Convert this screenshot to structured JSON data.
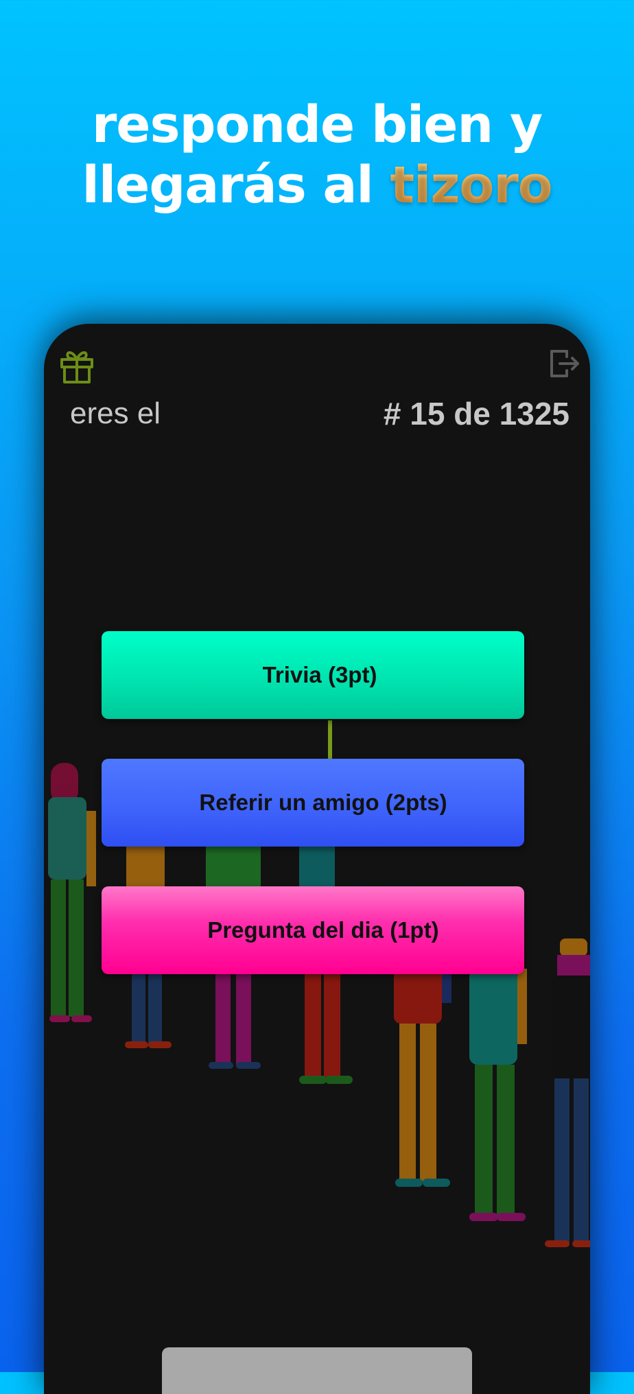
{
  "headline": {
    "line1": "responde bien y",
    "line2_prefix": "llegarás al ",
    "line2_accent": "tizoro"
  },
  "header": {
    "gift_icon": "gift-icon",
    "logout_icon": "logout-icon",
    "rank_label": "eres el",
    "rank_value": "# 15 de 1325"
  },
  "options": {
    "trivia": "Trivia (3pt)",
    "refer": "Referir un amigo (2pts)",
    "pregunta": "Pregunta del dia (1pt)"
  },
  "colors": {
    "background_top": "#00c3ff",
    "background_bottom": "#0a63ee",
    "accent": "#f7b457",
    "device": "#121212",
    "trivia": "#00e4b0",
    "refer": "#3f64fb",
    "pregunta": "#ff0090",
    "icon_green": "#7a9b1a"
  }
}
